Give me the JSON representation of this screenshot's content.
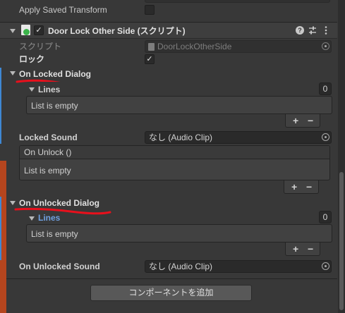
{
  "top": {
    "apply_saved_transform_label": "Apply Saved Transform"
  },
  "component": {
    "title": "Door Lock Other Side (スクリプト)",
    "script_label": "スクリプト",
    "script_value": "DoorLockOtherSide",
    "lock_label": "ロック",
    "lock_checked": "✓"
  },
  "on_locked_dialog": {
    "label": "On Locked Dialog",
    "lines_label": "Lines",
    "lines_count": "0",
    "empty_text": "List is empty",
    "plus": "+",
    "minus": "−"
  },
  "locked_sound": {
    "label": "Locked Sound",
    "value": "なし (Audio Clip)"
  },
  "on_unlock": {
    "header": "On Unlock ()",
    "empty_text": "List is empty",
    "plus": "+",
    "minus": "−"
  },
  "on_unlocked_dialog": {
    "label": "On Unlocked Dialog",
    "lines_label": "Lines",
    "lines_count": "0",
    "empty_text": "List is empty",
    "plus": "+",
    "minus": "−"
  },
  "on_unlocked_sound": {
    "label": "On Unlocked Sound",
    "value": "なし (Audio Clip)"
  },
  "footer": {
    "add_component_label": "コンポーネントを追加"
  },
  "colors": {
    "background": "#383838",
    "accent_blue": "#3f88d4",
    "annotation_red": "#e8101c",
    "left_strip": "#b5451e"
  }
}
